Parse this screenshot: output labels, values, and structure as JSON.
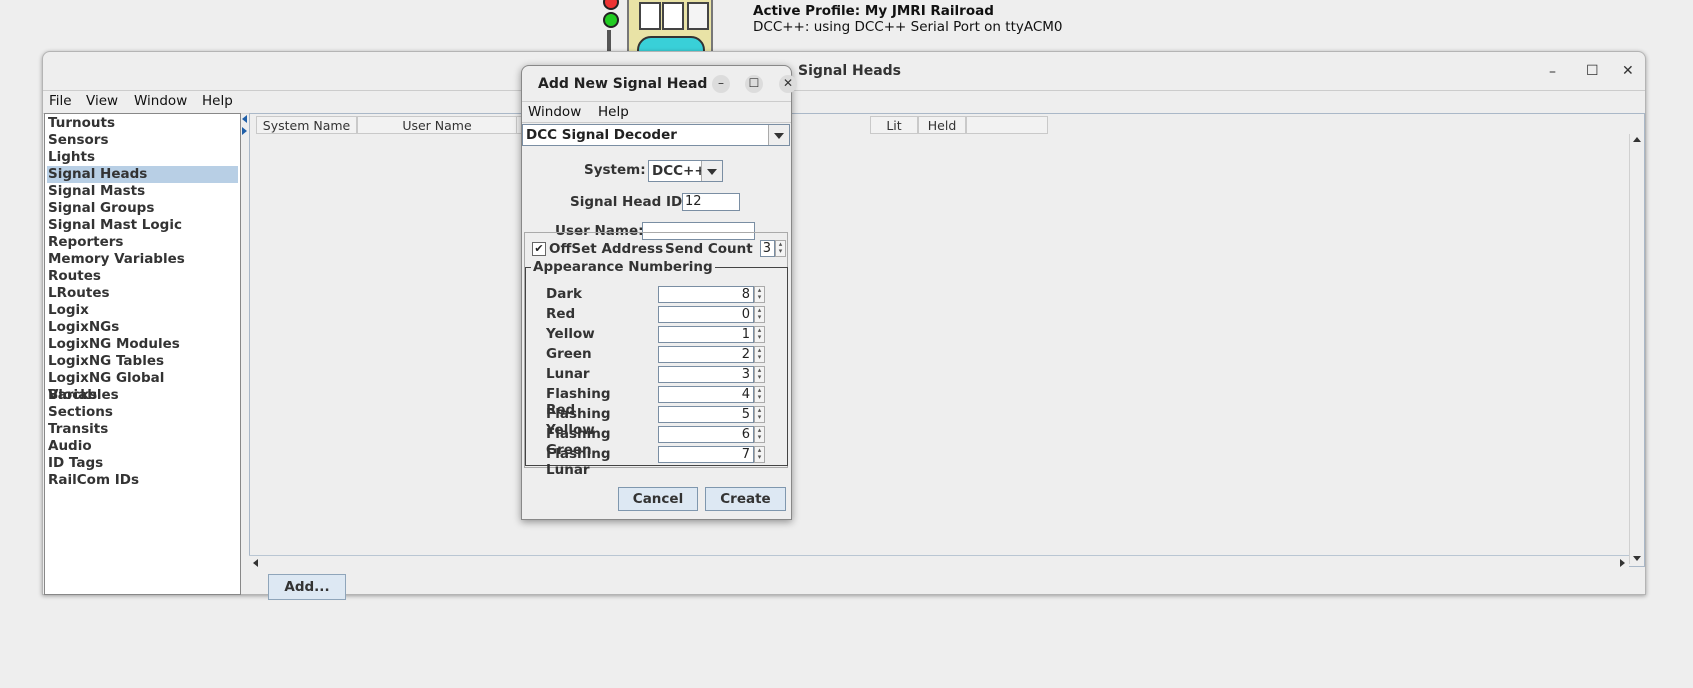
{
  "background": {
    "profile_line": "Active Profile: My JMRI Railroad",
    "connection_line": "DCC++: using DCC++ Serial Port on ttyACM0"
  },
  "main_window": {
    "title": "Signal Heads",
    "menu": [
      "File",
      "View",
      "Window",
      "Help"
    ],
    "nav_items": [
      "Turnouts",
      "Sensors",
      "Lights",
      "Signal Heads",
      "Signal Masts",
      "Signal Groups",
      "Signal Mast Logic",
      "Reporters",
      "Memory Variables",
      "Routes",
      "LRoutes",
      "Logix",
      "LogixNGs",
      "LogixNG Modules",
      "LogixNG Tables",
      "LogixNG Global Variables",
      "Blocks",
      "Sections",
      "Transits",
      "Audio",
      "ID Tags",
      "RailCom IDs"
    ],
    "selected_nav": "Signal Heads",
    "columns": [
      "System Name",
      "User Name",
      "Lit",
      "Held"
    ],
    "add_button": "Add..."
  },
  "dialog": {
    "title": "Add New Signal Head",
    "menu": [
      "Window",
      "Help"
    ],
    "type_selected": "DCC Signal Decoder",
    "system_label": "System:",
    "system_value": "DCC++",
    "head_id_label": "Signal Head ID",
    "head_id_value": "12",
    "user_name_label": "User Name:",
    "user_name_value": "",
    "offset_label": "OffSet Address",
    "offset_checked": true,
    "send_count_label": "Send Count",
    "send_count_value": "3",
    "group_title": "Appearance Numbering",
    "appearances": [
      {
        "label": "Dark",
        "value": "8"
      },
      {
        "label": "Red",
        "value": "0"
      },
      {
        "label": "Yellow",
        "value": "1"
      },
      {
        "label": "Green",
        "value": "2"
      },
      {
        "label": "Lunar",
        "value": "3"
      },
      {
        "label": "Flashing Red",
        "value": "4"
      },
      {
        "label": "Flashing Yellow",
        "value": "5"
      },
      {
        "label": "Flashing Green",
        "value": "6"
      },
      {
        "label": "Flashing Lunar",
        "value": "7"
      }
    ],
    "cancel_button": "Cancel",
    "create_button": "Create"
  },
  "icons": {
    "check": "✔",
    "minimize": "–",
    "maximize": "☐",
    "close": "✕"
  },
  "colors": {
    "selection": "#b8cfe5",
    "button_bg": "#dde8f3",
    "accent_cyan": "#39d0d8"
  }
}
